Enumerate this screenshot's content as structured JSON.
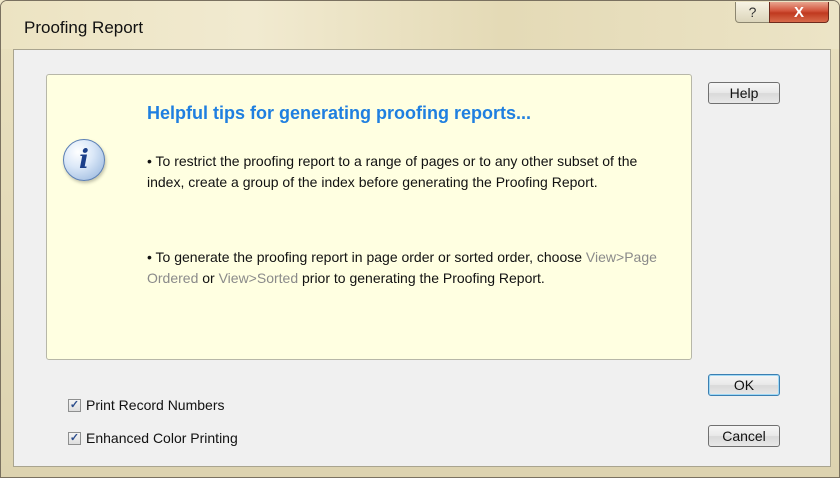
{
  "window": {
    "title": "Proofing Report",
    "help_glyph": "?",
    "close_glyph": "X"
  },
  "tips": {
    "icon": "information-icon",
    "icon_glyph": "i",
    "heading": "Helpful tips for generating proofing reports...",
    "tip1": "• To restrict the proofing report to a range of pages or to any other subset of the index, create a group of the index before generating the Proofing Report.",
    "tip2_before": "• To generate the proofing report in page order or sorted order, choose ",
    "tip2_menu1": "View>Page Ordered",
    "tip2_middle": " or ",
    "tip2_menu2": "View>Sorted",
    "tip2_after": " prior to generating the Proofing Report."
  },
  "buttons": {
    "help": "Help",
    "ok": "OK",
    "cancel": "Cancel"
  },
  "options": {
    "print_record_numbers": {
      "label": "Print Record Numbers",
      "checked": true,
      "glyph": "✓"
    },
    "enhanced_color_printing": {
      "label": "Enhanced Color Printing",
      "checked": true,
      "glyph": "✓"
    }
  },
  "colors": {
    "heading": "#1f7fe0",
    "menu_reference": "#8a8a8a",
    "tips_background": "#ffffe1",
    "close_button": "#c0391f"
  }
}
